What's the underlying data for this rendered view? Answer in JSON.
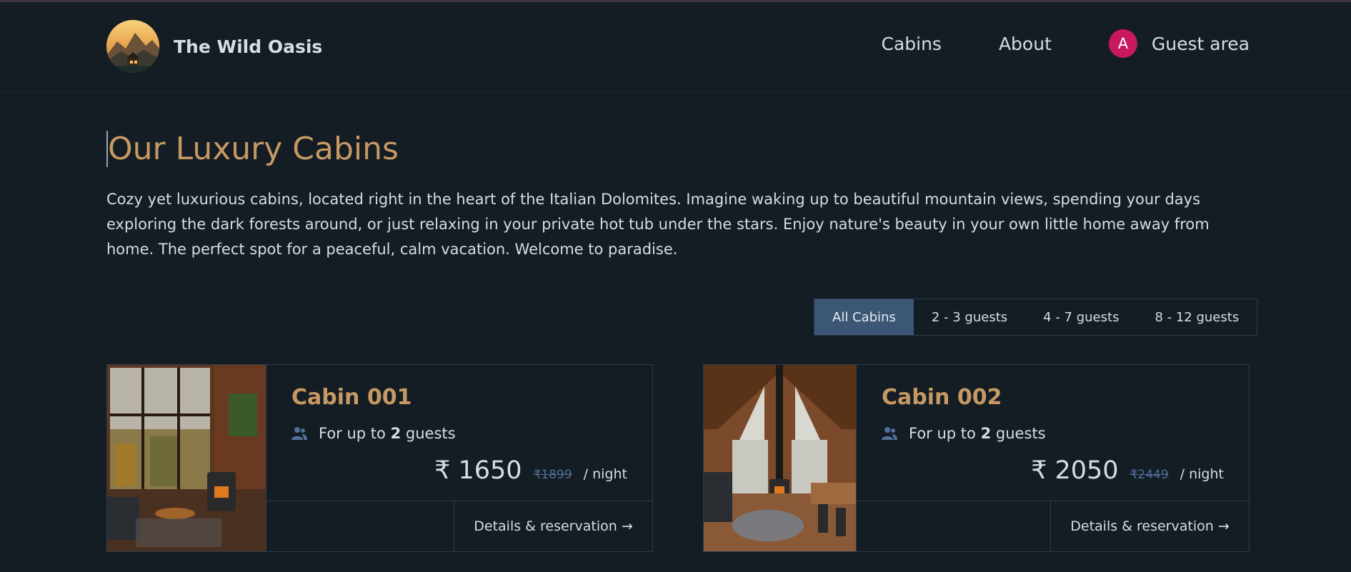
{
  "brand": {
    "name": "The Wild Oasis"
  },
  "nav": {
    "cabins": "Cabins",
    "about": "About",
    "avatar_initial": "A",
    "guest_area": "Guest area"
  },
  "page": {
    "title": "Our Luxury Cabins",
    "intro": "Cozy yet luxurious cabins, located right in the heart of the Italian Dolomites. Imagine waking up to beautiful mountain views, spending your days exploring the dark forests around, or just relaxing in your private hot tub under the stars. Enjoy nature's beauty in your own little home away from home. The perfect spot for a peaceful, calm vacation. Welcome to paradise."
  },
  "filters": {
    "all": "All Cabins",
    "small": "2 - 3 guests",
    "medium": "4 - 7 guests",
    "large": "8 - 12 guests",
    "active": "All Cabins"
  },
  "cabins": [
    {
      "name": "Cabin 001",
      "guests_prefix": "For up to",
      "guests_count": "2",
      "guests_suffix": "guests",
      "price": "₹ 1650",
      "original_price": "₹1899",
      "unit": "/ night",
      "details": "Details & reservation →"
    },
    {
      "name": "Cabin 002",
      "guests_prefix": "For up to",
      "guests_count": "2",
      "guests_suffix": "guests",
      "price": "₹ 2050",
      "original_price": "₹2449",
      "unit": "/ night",
      "details": "Details & reservation →"
    }
  ],
  "colors": {
    "background": "#141c24",
    "accent": "#c69963",
    "filter_active": "#3c5675",
    "avatar": "#c8195e"
  }
}
